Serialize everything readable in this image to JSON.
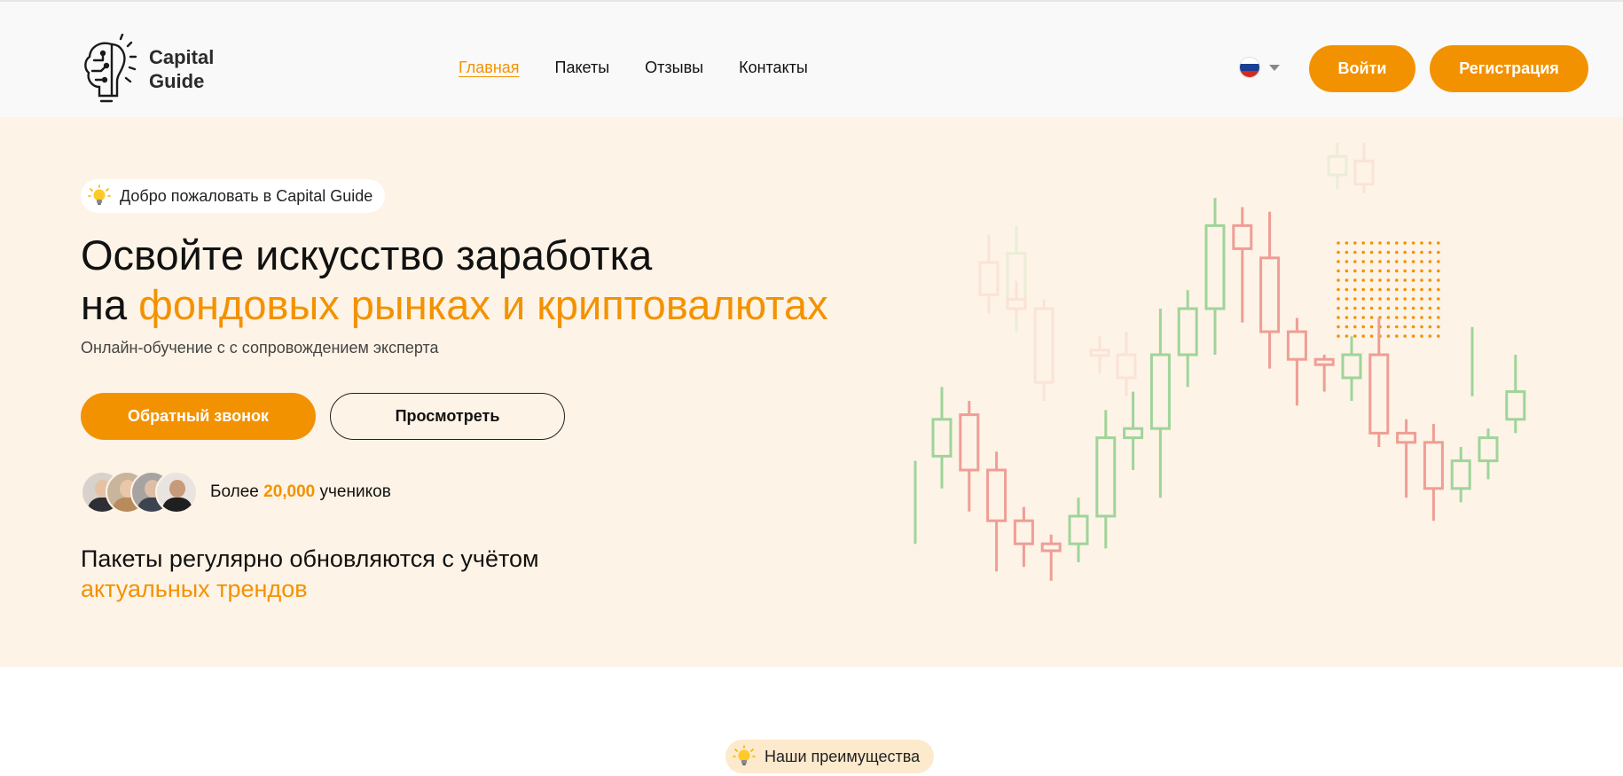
{
  "header": {
    "logo_line1": "Capital",
    "logo_line2": "Guide",
    "nav": [
      {
        "label": "Главная",
        "active": true
      },
      {
        "label": "Пакеты",
        "active": false
      },
      {
        "label": "Отзывы",
        "active": false
      },
      {
        "label": "Контакты",
        "active": false
      }
    ],
    "language_icon": "russia-flag-icon",
    "login_label": "Войти",
    "register_label": "Регистрация"
  },
  "hero": {
    "welcome_badge": "Добро пожаловать в Capital Guide",
    "headline_line1": "Освойте искусство заработка",
    "headline_line2_prefix": "на ",
    "headline_line2_accent": "фондовых рынках и криптовалютах",
    "subline": "Онлайн-обучение с с сопровождением эксперта",
    "callback_label": "Обратный звонок",
    "view_label": "Просмотреть",
    "students_prefix": "Более",
    "students_count": "20,000",
    "students_suffix": "учеников",
    "tagline_line1": "Пакеты регулярно обновляются с учётом",
    "tagline_line2": "актуальных трендов"
  },
  "advantages_badge": "Наши преимущества",
  "colors": {
    "accent": "#f39200",
    "hero_bg": "#fdf3e6",
    "candle_up": "#9fd49a",
    "candle_down": "#ee9e96"
  },
  "candles": [
    {
      "open": 3.8,
      "close": 4.6,
      "high": 5.3,
      "low": 3.1,
      "faded": false
    },
    {
      "open": 4.7,
      "close": 3.5,
      "high": 5.0,
      "low": 2.6,
      "faded": false
    },
    {
      "open": 3.5,
      "close": 2.4,
      "high": 3.9,
      "low": 1.3,
      "faded": false
    },
    {
      "open": 2.4,
      "close": 1.9,
      "high": 2.7,
      "low": 1.4,
      "faded": false
    },
    {
      "open": 1.9,
      "close": 1.75,
      "high": 2.1,
      "low": 1.1,
      "faded": false
    },
    {
      "open": 1.9,
      "close": 2.5,
      "high": 2.9,
      "low": 1.5,
      "faded": false
    },
    {
      "open": 2.5,
      "close": 4.2,
      "high": 4.8,
      "low": 1.8,
      "faded": false
    },
    {
      "open": 4.2,
      "close": 4.4,
      "high": 5.2,
      "low": 3.5,
      "faded": false
    },
    {
      "open": 4.4,
      "close": 6.0,
      "high": 7.0,
      "low": 2.9,
      "faded": false
    },
    {
      "open": 6.0,
      "close": 7.0,
      "high": 7.4,
      "low": 5.3,
      "faded": false
    },
    {
      "open": 7.0,
      "close": 8.8,
      "high": 9.4,
      "low": 6.0,
      "faded": false
    },
    {
      "open": 8.8,
      "close": 8.3,
      "high": 9.2,
      "low": 6.7,
      "faded": false
    },
    {
      "open": 8.1,
      "close": 6.5,
      "high": 9.1,
      "low": 5.7,
      "faded": false
    },
    {
      "open": 6.5,
      "close": 5.9,
      "high": 6.8,
      "low": 4.9,
      "faded": false
    },
    {
      "open": 5.9,
      "close": 5.8,
      "high": 6.0,
      "low": 5.2,
      "faded": false
    },
    {
      "open": 5.5,
      "close": 6.0,
      "high": 6.4,
      "low": 5.0,
      "faded": false
    },
    {
      "open": 6.0,
      "close": 4.3,
      "high": 6.8,
      "low": 4.0,
      "faded": false
    },
    {
      "open": 4.3,
      "close": 4.1,
      "high": 4.6,
      "low": 2.9,
      "faded": false
    },
    {
      "open": 4.1,
      "close": 3.1,
      "high": 4.5,
      "low": 2.4,
      "faded": false
    },
    {
      "open": 3.1,
      "close": 3.7,
      "high": 4.0,
      "low": 2.8,
      "faded": false
    },
    {
      "open": 3.7,
      "close": 4.2,
      "high": 4.4,
      "low": 3.3,
      "faded": false
    },
    {
      "open": 4.6,
      "close": 5.2,
      "high": 6.0,
      "low": 4.3,
      "faded": false
    }
  ],
  "faded_candles": [
    {
      "open": 8.0,
      "close": 7.3,
      "high": 8.6,
      "low": 6.9
    },
    {
      "open": 7.2,
      "close": 8.2,
      "high": 8.8,
      "low": 6.5
    },
    {
      "open": 7.2,
      "close": 7.0,
      "high": 7.6,
      "low": 6.8
    },
    {
      "open": 7.0,
      "close": 5.4,
      "high": 7.2,
      "low": 5.0
    },
    {
      "open": 6.1,
      "close": 6.0,
      "high": 6.4,
      "low": 5.6
    },
    {
      "open": 6.0,
      "close": 5.5,
      "high": 6.5,
      "low": 5.1
    },
    {
      "open": 9.9,
      "close": 10.3,
      "high": 10.6,
      "low": 9.6
    },
    {
      "open": 10.2,
      "close": 9.7,
      "high": 10.6,
      "low": 9.5
    }
  ]
}
